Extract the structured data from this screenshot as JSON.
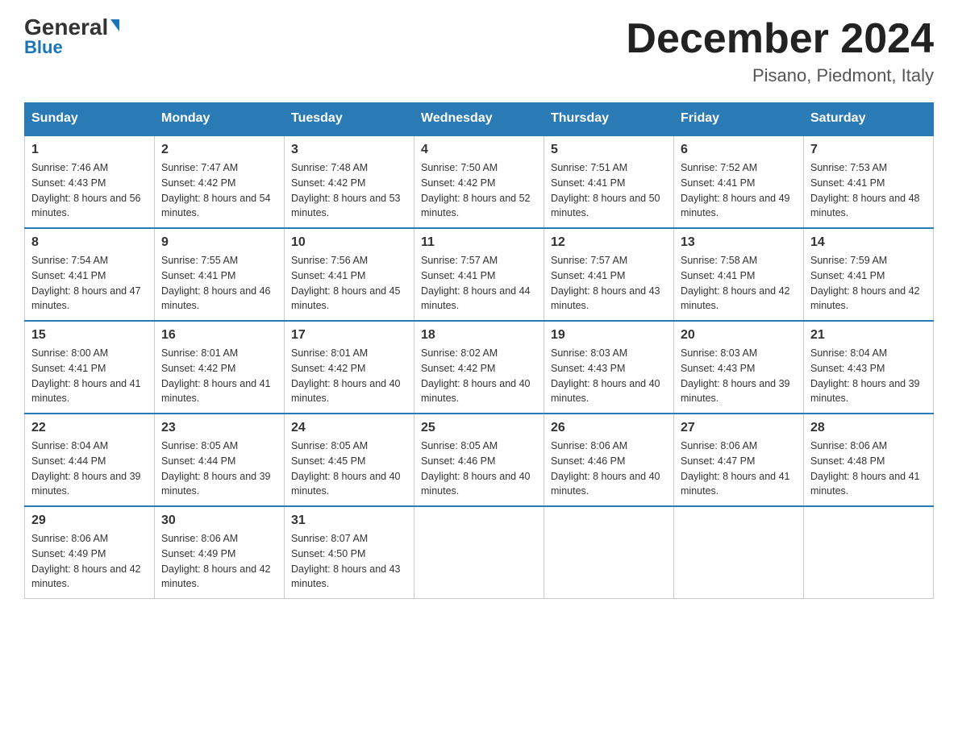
{
  "logo": {
    "general": "General",
    "blue": "Blue"
  },
  "header": {
    "month": "December 2024",
    "location": "Pisano, Piedmont, Italy"
  },
  "days_of_week": [
    "Sunday",
    "Monday",
    "Tuesday",
    "Wednesday",
    "Thursday",
    "Friday",
    "Saturday"
  ],
  "weeks": [
    [
      {
        "day": "1",
        "sunrise": "7:46 AM",
        "sunset": "4:43 PM",
        "daylight": "8 hours and 56 minutes."
      },
      {
        "day": "2",
        "sunrise": "7:47 AM",
        "sunset": "4:42 PM",
        "daylight": "8 hours and 54 minutes."
      },
      {
        "day": "3",
        "sunrise": "7:48 AM",
        "sunset": "4:42 PM",
        "daylight": "8 hours and 53 minutes."
      },
      {
        "day": "4",
        "sunrise": "7:50 AM",
        "sunset": "4:42 PM",
        "daylight": "8 hours and 52 minutes."
      },
      {
        "day": "5",
        "sunrise": "7:51 AM",
        "sunset": "4:41 PM",
        "daylight": "8 hours and 50 minutes."
      },
      {
        "day": "6",
        "sunrise": "7:52 AM",
        "sunset": "4:41 PM",
        "daylight": "8 hours and 49 minutes."
      },
      {
        "day": "7",
        "sunrise": "7:53 AM",
        "sunset": "4:41 PM",
        "daylight": "8 hours and 48 minutes."
      }
    ],
    [
      {
        "day": "8",
        "sunrise": "7:54 AM",
        "sunset": "4:41 PM",
        "daylight": "8 hours and 47 minutes."
      },
      {
        "day": "9",
        "sunrise": "7:55 AM",
        "sunset": "4:41 PM",
        "daylight": "8 hours and 46 minutes."
      },
      {
        "day": "10",
        "sunrise": "7:56 AM",
        "sunset": "4:41 PM",
        "daylight": "8 hours and 45 minutes."
      },
      {
        "day": "11",
        "sunrise": "7:57 AM",
        "sunset": "4:41 PM",
        "daylight": "8 hours and 44 minutes."
      },
      {
        "day": "12",
        "sunrise": "7:57 AM",
        "sunset": "4:41 PM",
        "daylight": "8 hours and 43 minutes."
      },
      {
        "day": "13",
        "sunrise": "7:58 AM",
        "sunset": "4:41 PM",
        "daylight": "8 hours and 42 minutes."
      },
      {
        "day": "14",
        "sunrise": "7:59 AM",
        "sunset": "4:41 PM",
        "daylight": "8 hours and 42 minutes."
      }
    ],
    [
      {
        "day": "15",
        "sunrise": "8:00 AM",
        "sunset": "4:41 PM",
        "daylight": "8 hours and 41 minutes."
      },
      {
        "day": "16",
        "sunrise": "8:01 AM",
        "sunset": "4:42 PM",
        "daylight": "8 hours and 41 minutes."
      },
      {
        "day": "17",
        "sunrise": "8:01 AM",
        "sunset": "4:42 PM",
        "daylight": "8 hours and 40 minutes."
      },
      {
        "day": "18",
        "sunrise": "8:02 AM",
        "sunset": "4:42 PM",
        "daylight": "8 hours and 40 minutes."
      },
      {
        "day": "19",
        "sunrise": "8:03 AM",
        "sunset": "4:43 PM",
        "daylight": "8 hours and 40 minutes."
      },
      {
        "day": "20",
        "sunrise": "8:03 AM",
        "sunset": "4:43 PM",
        "daylight": "8 hours and 39 minutes."
      },
      {
        "day": "21",
        "sunrise": "8:04 AM",
        "sunset": "4:43 PM",
        "daylight": "8 hours and 39 minutes."
      }
    ],
    [
      {
        "day": "22",
        "sunrise": "8:04 AM",
        "sunset": "4:44 PM",
        "daylight": "8 hours and 39 minutes."
      },
      {
        "day": "23",
        "sunrise": "8:05 AM",
        "sunset": "4:44 PM",
        "daylight": "8 hours and 39 minutes."
      },
      {
        "day": "24",
        "sunrise": "8:05 AM",
        "sunset": "4:45 PM",
        "daylight": "8 hours and 40 minutes."
      },
      {
        "day": "25",
        "sunrise": "8:05 AM",
        "sunset": "4:46 PM",
        "daylight": "8 hours and 40 minutes."
      },
      {
        "day": "26",
        "sunrise": "8:06 AM",
        "sunset": "4:46 PM",
        "daylight": "8 hours and 40 minutes."
      },
      {
        "day": "27",
        "sunrise": "8:06 AM",
        "sunset": "4:47 PM",
        "daylight": "8 hours and 41 minutes."
      },
      {
        "day": "28",
        "sunrise": "8:06 AM",
        "sunset": "4:48 PM",
        "daylight": "8 hours and 41 minutes."
      }
    ],
    [
      {
        "day": "29",
        "sunrise": "8:06 AM",
        "sunset": "4:49 PM",
        "daylight": "8 hours and 42 minutes."
      },
      {
        "day": "30",
        "sunrise": "8:06 AM",
        "sunset": "4:49 PM",
        "daylight": "8 hours and 42 minutes."
      },
      {
        "day": "31",
        "sunrise": "8:07 AM",
        "sunset": "4:50 PM",
        "daylight": "8 hours and 43 minutes."
      },
      null,
      null,
      null,
      null
    ]
  ],
  "labels": {
    "sunrise": "Sunrise:",
    "sunset": "Sunset:",
    "daylight": "Daylight:"
  }
}
